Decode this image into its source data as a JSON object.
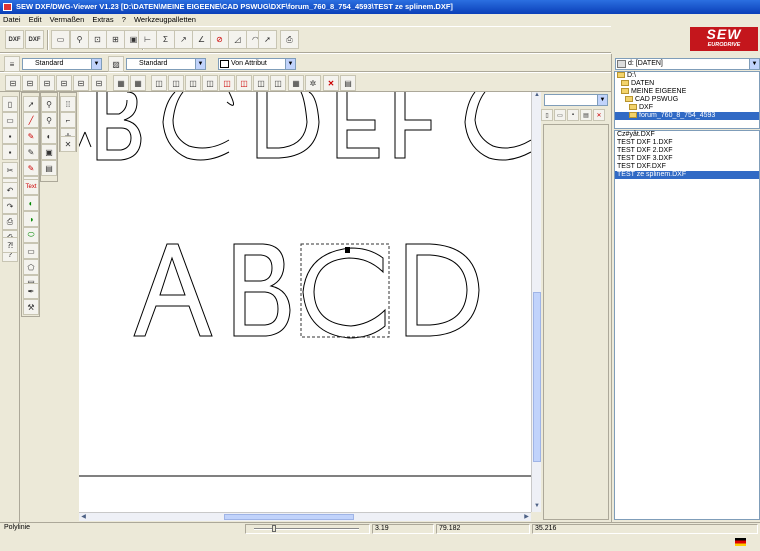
{
  "window": {
    "title": "SEW DXF/DWG-Viewer V1.23 [D:\\DATEN\\MEINE EIGEENE\\CAD PSWUG\\DXF\\forum_760_8_754_4593\\TEST ze splinem.DXF]"
  },
  "menu": {
    "items": [
      "Datei",
      "Edit",
      "Vermaßen",
      "Extras",
      "?",
      "Werkzeugpalletten"
    ]
  },
  "toolbar": {
    "buttons": [
      {
        "name": "dxf-export-button",
        "icon": "dxf-icon",
        "label": "DXF"
      },
      {
        "name": "dxf-import-button",
        "icon": "dxf-icon",
        "label": "DXF"
      },
      {
        "name": "open-file-button",
        "icon": "open-file-icon",
        "label": ""
      },
      {
        "name": "zoom-button",
        "icon": "magnifier-icon",
        "label": ""
      },
      {
        "name": "zoom-window-button",
        "icon": "zoom-window-icon",
        "label": ""
      },
      {
        "name": "zoom-all-button",
        "icon": "zoom-all-icon",
        "label": ""
      },
      {
        "name": "zoom-previous-button",
        "icon": "zoom-previous-icon",
        "label": ""
      },
      {
        "name": "dimension-horizontal-button",
        "icon": "dimension-horizontal-icon",
        "label": ""
      },
      {
        "name": "dimension-vertical-button",
        "icon": "dimension-vertical-icon",
        "label": ""
      },
      {
        "name": "dimension-aligned-button",
        "icon": "dimension-aligned-icon",
        "label": ""
      },
      {
        "name": "dimension-angle-button",
        "icon": "dimension-angle-icon",
        "label": ""
      },
      {
        "name": "dimension-diameter-button",
        "icon": "dimension-diameter-icon",
        "label": ""
      },
      {
        "name": "dimension-radius-button",
        "icon": "dimension-radius-icon",
        "label": ""
      },
      {
        "name": "dimension-arc-button",
        "icon": "dimension-arc-icon",
        "label": ""
      },
      {
        "name": "select-button",
        "icon": "cursor-arrow-icon",
        "label": ""
      },
      {
        "name": "print-button",
        "icon": "printer-icon",
        "label": ""
      }
    ]
  },
  "layer_bar": {
    "layer_combo": "Standard",
    "linetype_combo": "Standard",
    "color_combo": "Von Attribut"
  },
  "logo": {
    "text": "SEW",
    "subtext": "EURODRIVE"
  },
  "drive": {
    "selected": "d: [DATEN]"
  },
  "folder_tree": [
    {
      "label": "D:\\",
      "depth": 0
    },
    {
      "label": "DATEN",
      "depth": 1
    },
    {
      "label": "MEINE EIGEENE",
      "depth": 2
    },
    {
      "label": "CAD PSWUG",
      "depth": 3
    },
    {
      "label": "DXF",
      "depth": 4
    },
    {
      "label": "forum_760_8_754_4593",
      "depth": 5,
      "selected": true
    }
  ],
  "file_list": [
    {
      "label": "Cz#yât.DXF"
    },
    {
      "label": "TEST DXF 1.DXF"
    },
    {
      "label": "TEST DXF 2.DXF"
    },
    {
      "label": "TEST DXF 3.DXF"
    },
    {
      "label": "TEST DXF.DXF"
    },
    {
      "label": "TEST ze splinem.DXF",
      "selected": true
    }
  ],
  "left_palette": {
    "text_tool_label": "Text"
  },
  "status": {
    "object_type": "Polylinie",
    "value1": "3.19",
    "value2": "79.182",
    "value3": "35.216"
  },
  "colors": {
    "titlebar": "#0a3fb8",
    "selection": "#316ac5",
    "logo": "#c4161c"
  }
}
